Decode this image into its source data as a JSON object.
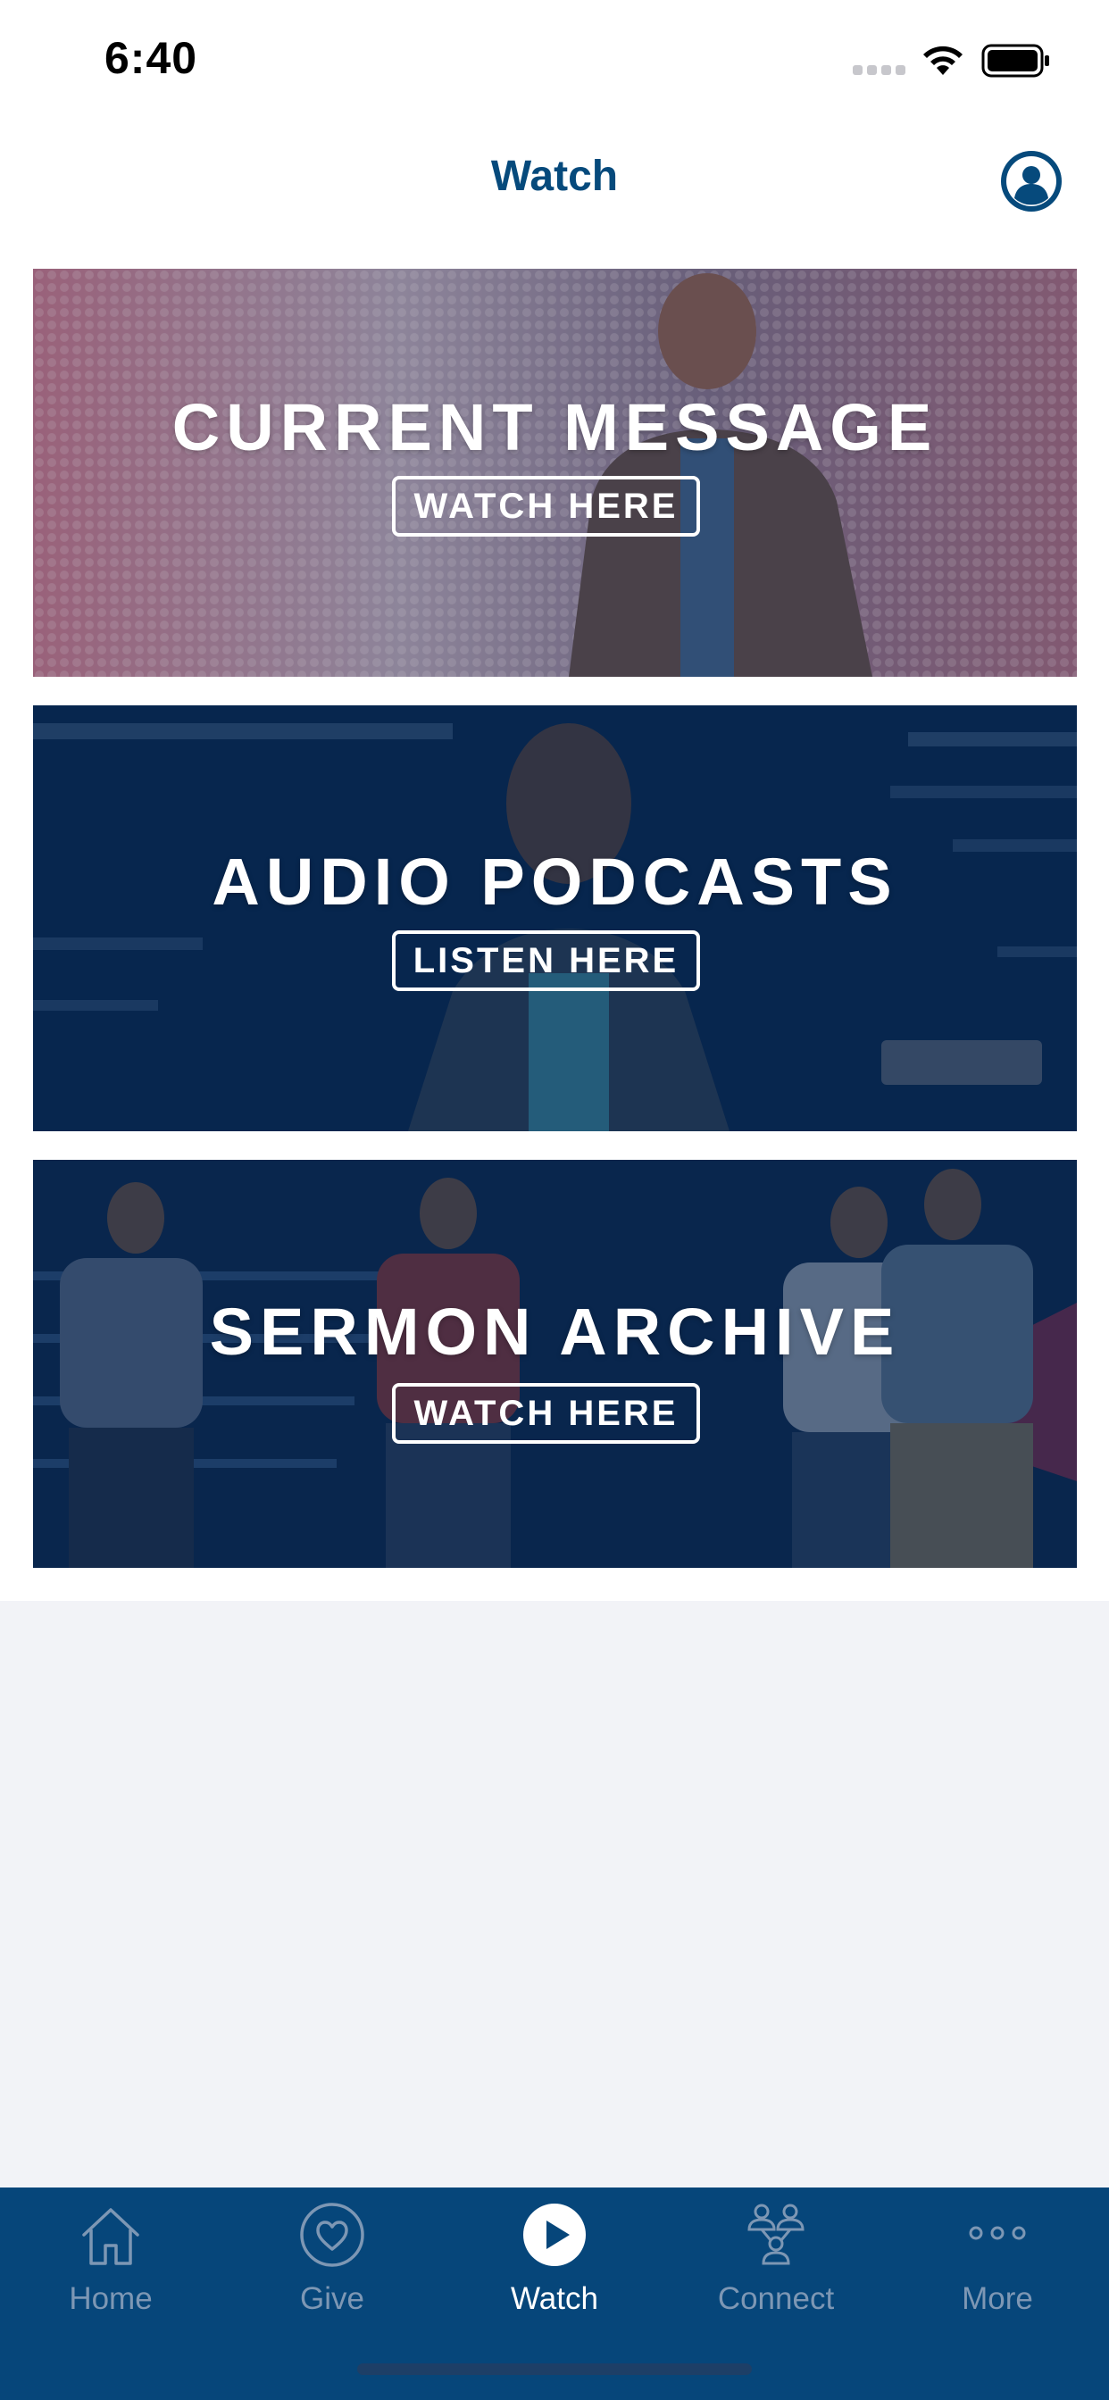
{
  "status_bar": {
    "time": "6:40"
  },
  "nav": {
    "title": "Watch",
    "profile_icon": "person-circle-icon"
  },
  "banners": [
    {
      "title": "CURRENT MESSAGE",
      "cta": "WATCH HERE"
    },
    {
      "title": "AUDIO PODCASTS",
      "cta": "LISTEN HERE"
    },
    {
      "title": "SERMON ARCHIVE",
      "cta": "WATCH HERE"
    }
  ],
  "tab_bar": {
    "tabs": [
      {
        "label": "Home",
        "icon": "home-icon",
        "active": false
      },
      {
        "label": "Give",
        "icon": "heart-icon",
        "active": false
      },
      {
        "label": "Watch",
        "icon": "play-icon",
        "active": true
      },
      {
        "label": "Connect",
        "icon": "people-icon",
        "active": false
      },
      {
        "label": "More",
        "icon": "more-icon",
        "active": false
      }
    ]
  },
  "colors": {
    "brand_blue": "#064a7c",
    "tab_bar_bg": "#06467a",
    "tab_inactive": "#7d97b4",
    "tab_active": "#ffffff"
  }
}
